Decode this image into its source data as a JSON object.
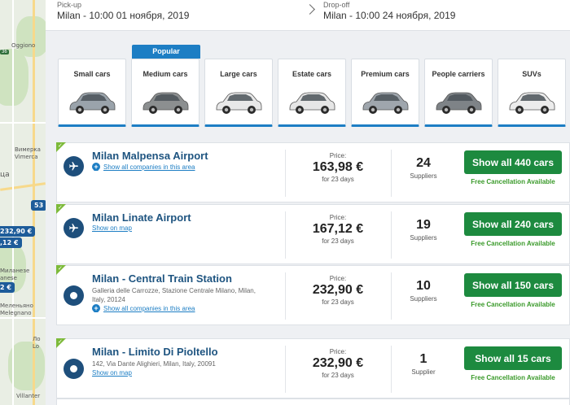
{
  "map": {
    "labels": [
      "Oggiono",
      "Вимерка",
      "Vimerca",
      "ца",
      "Миланезе",
      "anese",
      "Меленьяно",
      "Melegnano",
      "Ло",
      "Lo",
      "Villanter"
    ],
    "route_shields": [
      "36"
    ],
    "price_pins": [
      "53",
      "232,90 €",
      ",12 €",
      "2 €"
    ]
  },
  "header": {
    "pickup_label": "Pick-up",
    "pickup_value": "Milan - 10:00 01 ноября, 2019",
    "dropoff_label": "Drop-off",
    "dropoff_value": "Milan - 10:00 24 ноября, 2019"
  },
  "categories": {
    "popular_tag": "Popular",
    "items": [
      {
        "label": "Small cars",
        "color": "#9aa3ab"
      },
      {
        "label": "Medium cars",
        "color": "#8c8f90"
      },
      {
        "label": "Large cars",
        "color": "#e8e8e8"
      },
      {
        "label": "Estate cars",
        "color": "#e6e6e6"
      },
      {
        "label": "Premium cars",
        "color": "#9fa6ad"
      },
      {
        "label": "People carriers",
        "color": "#7e8387"
      },
      {
        "label": "SUVs",
        "color": "#ececec"
      }
    ]
  },
  "results": [
    {
      "title": "Milan Malpensa Airport",
      "icon": "plane-icon",
      "address": "",
      "link": "Show all companies in this area",
      "price_label": "Price:",
      "price": "163,98 €",
      "days": "for 23 days",
      "suppliers": "24",
      "suppliers_label": "Suppliers",
      "cta": "Show all 440 cars",
      "free_cancel": "Free Cancellation Available"
    },
    {
      "title": "Milan Linate Airport",
      "icon": "plane-icon",
      "address": "",
      "link": "Show on map",
      "price_label": "Price:",
      "price": "167,12 €",
      "days": "for 23 days",
      "suppliers": "19",
      "suppliers_label": "Suppliers",
      "cta": "Show all 240 cars",
      "free_cancel": "Free Cancellation Available"
    },
    {
      "title": "Milan - Central Train Station",
      "icon": "location-dot-icon",
      "address": "Galleria delle Carrozze, Stazione Centrale Milano, Milan, Italy, 20124",
      "link": "Show all companies in this area",
      "price_label": "Price:",
      "price": "232,90 €",
      "days": "for 23 days",
      "suppliers": "10",
      "suppliers_label": "Suppliers",
      "cta": "Show all 150 cars",
      "free_cancel": "Free Cancellation Available"
    },
    {
      "title": "Milan - Limito Di Pioltello",
      "icon": "location-dot-icon",
      "address": "142, Via Dante Alighieri, Milan, Italy, 20091",
      "link": "Show on map",
      "price_label": "Price:",
      "price": "232,90 €",
      "days": "for 23 days",
      "suppliers": "1",
      "suppliers_label": "Supplier",
      "cta": "Show all 15 cars",
      "free_cancel": "Free Cancellation Available"
    }
  ],
  "colors": {
    "accent_blue": "#1d7ec4",
    "title_blue": "#1e5480",
    "cta_green": "#1d8a3f",
    "free_green": "#3a9a2a",
    "badge_green": "#7dba3a"
  }
}
